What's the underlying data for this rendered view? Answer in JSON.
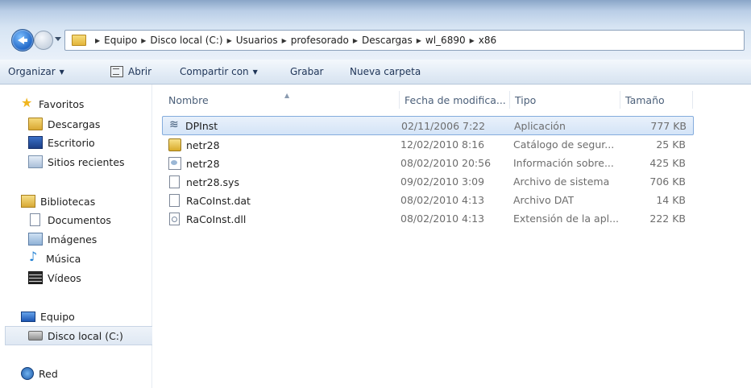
{
  "address": {
    "crumbs": [
      "Equipo",
      "Disco local (C:)",
      "Usuarios",
      "profesorado",
      "Descargas",
      "wl_6890",
      "x86"
    ]
  },
  "toolbar": {
    "organize": "Organizar",
    "open": "Abrir",
    "share": "Compartir con",
    "burn": "Grabar",
    "new_folder": "Nueva carpeta"
  },
  "nav": {
    "favorites": "Favoritos",
    "downloads": "Descargas",
    "desktop": "Escritorio",
    "recent": "Sitios recientes",
    "libraries": "Bibliotecas",
    "documents": "Documentos",
    "images": "Imágenes",
    "music": "Música",
    "videos": "Vídeos",
    "computer": "Equipo",
    "local_disk": "Disco local (C:)",
    "network": "Red"
  },
  "columns": {
    "name": "Nombre",
    "date": "Fecha de modifica...",
    "type": "Tipo",
    "size": "Tamaño"
  },
  "files": [
    {
      "name": "DPInst",
      "date": "02/11/2006 7:22",
      "type": "Aplicación",
      "size": "777 KB",
      "icon": "application-icon"
    },
    {
      "name": "netr28",
      "date": "12/02/2010 8:16",
      "type": "Catálogo de segur...",
      "size": "25 KB",
      "icon": "security-catalog-icon"
    },
    {
      "name": "netr28",
      "date": "08/02/2010 20:56",
      "type": "Información sobre...",
      "size": "425 KB",
      "icon": "setup-info-icon"
    },
    {
      "name": "netr28.sys",
      "date": "09/02/2010 3:09",
      "type": "Archivo de sistema",
      "size": "706 KB",
      "icon": "system-file-icon"
    },
    {
      "name": "RaCoInst.dat",
      "date": "08/02/2010 4:13",
      "type": "Archivo DAT",
      "size": "14 KB",
      "icon": "dat-file-icon"
    },
    {
      "name": "RaCoInst.dll",
      "date": "08/02/2010 4:13",
      "type": "Extensión de la apl...",
      "size": "222 KB",
      "icon": "dll-file-icon"
    }
  ]
}
